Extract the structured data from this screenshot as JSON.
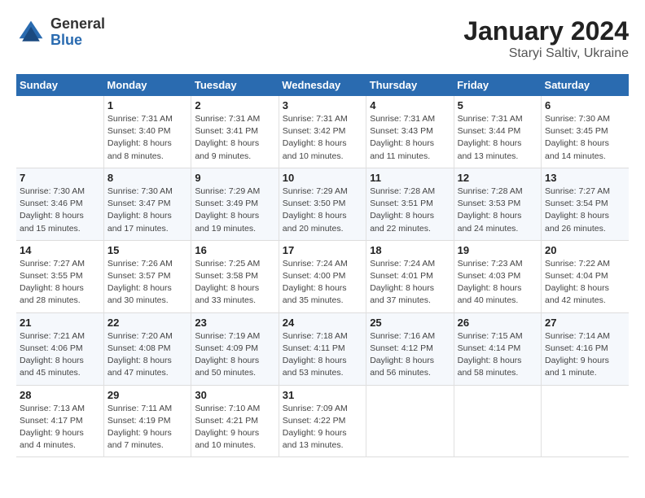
{
  "logo": {
    "general": "General",
    "blue": "Blue"
  },
  "title": {
    "month_year": "January 2024",
    "location": "Staryi Saltiv, Ukraine"
  },
  "headers": [
    "Sunday",
    "Monday",
    "Tuesday",
    "Wednesday",
    "Thursday",
    "Friday",
    "Saturday"
  ],
  "weeks": [
    [
      {
        "num": "",
        "info": ""
      },
      {
        "num": "1",
        "info": "Sunrise: 7:31 AM\nSunset: 3:40 PM\nDaylight: 8 hours\nand 8 minutes."
      },
      {
        "num": "2",
        "info": "Sunrise: 7:31 AM\nSunset: 3:41 PM\nDaylight: 8 hours\nand 9 minutes."
      },
      {
        "num": "3",
        "info": "Sunrise: 7:31 AM\nSunset: 3:42 PM\nDaylight: 8 hours\nand 10 minutes."
      },
      {
        "num": "4",
        "info": "Sunrise: 7:31 AM\nSunset: 3:43 PM\nDaylight: 8 hours\nand 11 minutes."
      },
      {
        "num": "5",
        "info": "Sunrise: 7:31 AM\nSunset: 3:44 PM\nDaylight: 8 hours\nand 13 minutes."
      },
      {
        "num": "6",
        "info": "Sunrise: 7:30 AM\nSunset: 3:45 PM\nDaylight: 8 hours\nand 14 minutes."
      }
    ],
    [
      {
        "num": "7",
        "info": "Sunrise: 7:30 AM\nSunset: 3:46 PM\nDaylight: 8 hours\nand 15 minutes."
      },
      {
        "num": "8",
        "info": "Sunrise: 7:30 AM\nSunset: 3:47 PM\nDaylight: 8 hours\nand 17 minutes."
      },
      {
        "num": "9",
        "info": "Sunrise: 7:29 AM\nSunset: 3:49 PM\nDaylight: 8 hours\nand 19 minutes."
      },
      {
        "num": "10",
        "info": "Sunrise: 7:29 AM\nSunset: 3:50 PM\nDaylight: 8 hours\nand 20 minutes."
      },
      {
        "num": "11",
        "info": "Sunrise: 7:28 AM\nSunset: 3:51 PM\nDaylight: 8 hours\nand 22 minutes."
      },
      {
        "num": "12",
        "info": "Sunrise: 7:28 AM\nSunset: 3:53 PM\nDaylight: 8 hours\nand 24 minutes."
      },
      {
        "num": "13",
        "info": "Sunrise: 7:27 AM\nSunset: 3:54 PM\nDaylight: 8 hours\nand 26 minutes."
      }
    ],
    [
      {
        "num": "14",
        "info": "Sunrise: 7:27 AM\nSunset: 3:55 PM\nDaylight: 8 hours\nand 28 minutes."
      },
      {
        "num": "15",
        "info": "Sunrise: 7:26 AM\nSunset: 3:57 PM\nDaylight: 8 hours\nand 30 minutes."
      },
      {
        "num": "16",
        "info": "Sunrise: 7:25 AM\nSunset: 3:58 PM\nDaylight: 8 hours\nand 33 minutes."
      },
      {
        "num": "17",
        "info": "Sunrise: 7:24 AM\nSunset: 4:00 PM\nDaylight: 8 hours\nand 35 minutes."
      },
      {
        "num": "18",
        "info": "Sunrise: 7:24 AM\nSunset: 4:01 PM\nDaylight: 8 hours\nand 37 minutes."
      },
      {
        "num": "19",
        "info": "Sunrise: 7:23 AM\nSunset: 4:03 PM\nDaylight: 8 hours\nand 40 minutes."
      },
      {
        "num": "20",
        "info": "Sunrise: 7:22 AM\nSunset: 4:04 PM\nDaylight: 8 hours\nand 42 minutes."
      }
    ],
    [
      {
        "num": "21",
        "info": "Sunrise: 7:21 AM\nSunset: 4:06 PM\nDaylight: 8 hours\nand 45 minutes."
      },
      {
        "num": "22",
        "info": "Sunrise: 7:20 AM\nSunset: 4:08 PM\nDaylight: 8 hours\nand 47 minutes."
      },
      {
        "num": "23",
        "info": "Sunrise: 7:19 AM\nSunset: 4:09 PM\nDaylight: 8 hours\nand 50 minutes."
      },
      {
        "num": "24",
        "info": "Sunrise: 7:18 AM\nSunset: 4:11 PM\nDaylight: 8 hours\nand 53 minutes."
      },
      {
        "num": "25",
        "info": "Sunrise: 7:16 AM\nSunset: 4:12 PM\nDaylight: 8 hours\nand 56 minutes."
      },
      {
        "num": "26",
        "info": "Sunrise: 7:15 AM\nSunset: 4:14 PM\nDaylight: 8 hours\nand 58 minutes."
      },
      {
        "num": "27",
        "info": "Sunrise: 7:14 AM\nSunset: 4:16 PM\nDaylight: 9 hours\nand 1 minute."
      }
    ],
    [
      {
        "num": "28",
        "info": "Sunrise: 7:13 AM\nSunset: 4:17 PM\nDaylight: 9 hours\nand 4 minutes."
      },
      {
        "num": "29",
        "info": "Sunrise: 7:11 AM\nSunset: 4:19 PM\nDaylight: 9 hours\nand 7 minutes."
      },
      {
        "num": "30",
        "info": "Sunrise: 7:10 AM\nSunset: 4:21 PM\nDaylight: 9 hours\nand 10 minutes."
      },
      {
        "num": "31",
        "info": "Sunrise: 7:09 AM\nSunset: 4:22 PM\nDaylight: 9 hours\nand 13 minutes."
      },
      {
        "num": "",
        "info": ""
      },
      {
        "num": "",
        "info": ""
      },
      {
        "num": "",
        "info": ""
      }
    ]
  ]
}
